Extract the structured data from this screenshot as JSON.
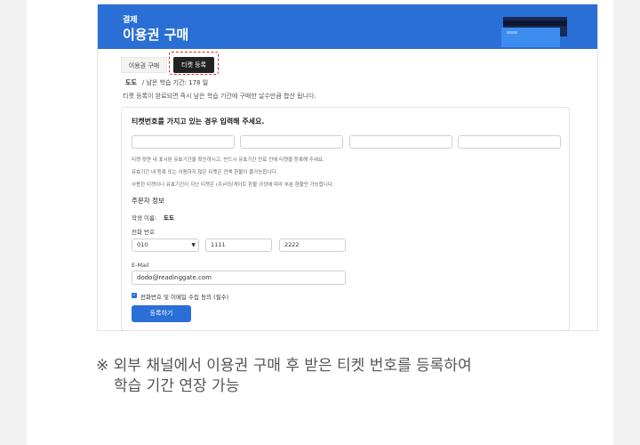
{
  "header": {
    "subtitle": "결제",
    "title": "이용권 구매"
  },
  "tabs": [
    {
      "label": "이용권 구매"
    },
    {
      "label": "티켓 등록"
    }
  ],
  "user": {
    "name": "도도",
    "remaining": "/ 남은 학습 기간: 178 일"
  },
  "notice": "티켓 등록이 완료되면 즉시 남은 학습 기간에 구매한 날수만큼 합산 됩니다.",
  "form": {
    "title": "티켓번호를 가지고 있는 경우 입력해 주세요.",
    "notes": [
      "티켓 뒷면 내 표시된 유효기간을 확인하시고, 반드시 유효기간 만료 전에 티켓을 등록해 주세요.",
      "유효기간 내 등록 또는 사용하지 않은 티켓은 전액 환불이 불가능합니다.",
      "사용한 티켓이나 유효기간이 지난 티켓은 (주)리딩게이트 환불 규정에 따라 부분 환불만 가능합니다."
    ],
    "orderer_title": "주문자 정보",
    "student_label": "학생 이름:",
    "student_value": "도도",
    "phone_label": "전화 번호",
    "phone_prefix": "010",
    "phone_mid": "1111",
    "phone_last": "2222",
    "email_label": "E-Mail",
    "email_value": "dodo@readinggate.com",
    "consent_label": "전화번호 및 이메일 수집 동의 (필수)",
    "submit_label": "등록하기"
  },
  "caption": {
    "line1": "※ 외부 채널에서 이용권 구매 후 받은 티켓 번호를 등록하여",
    "line2": "학습 기간 연장 가능"
  },
  "colors": {
    "accent": "#2a6fd6",
    "highlight": "#e0262b"
  }
}
